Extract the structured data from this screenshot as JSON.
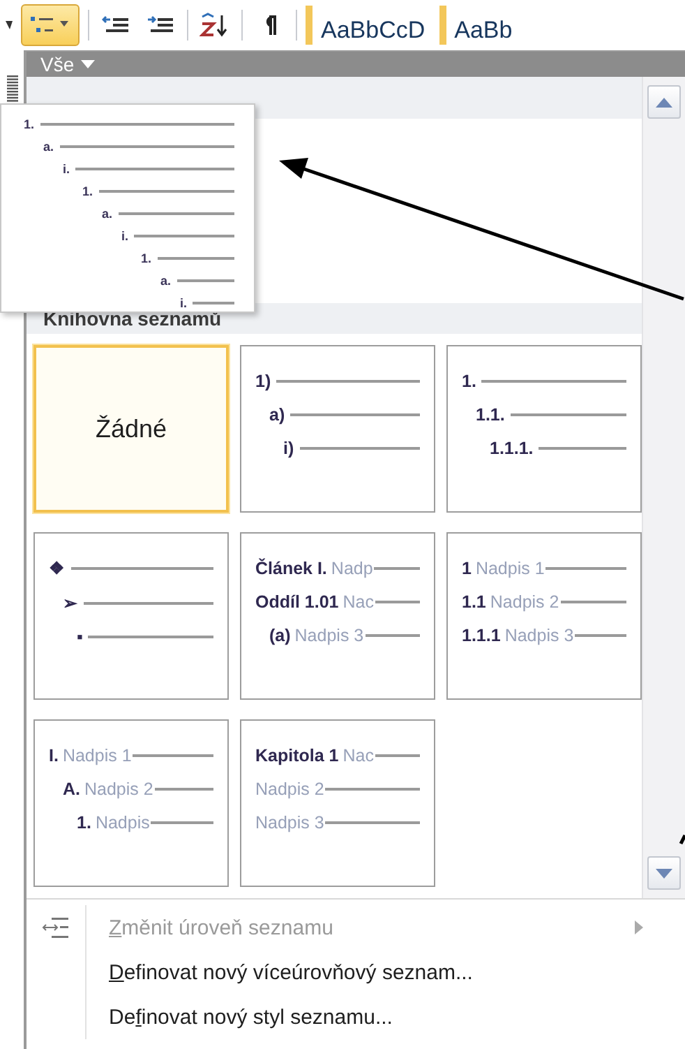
{
  "toolbar": {
    "buttons": [
      {
        "kind": "multilevel",
        "selected": true
      },
      {
        "kind": "outdent",
        "selected": false
      },
      {
        "kind": "indent",
        "selected": false
      },
      {
        "kind": "sort",
        "selected": false
      },
      {
        "kind": "pilcrow",
        "selected": false
      }
    ],
    "styles": [
      {
        "sample": "AaBbCcD"
      },
      {
        "sample": "AaBb"
      }
    ]
  },
  "gallery": {
    "filter": "Vše",
    "preview": {
      "marker": "1.",
      "children": [
        {
          "marker": "a.",
          "children": [
            {
              "marker": "i.",
              "children": [
                {
                  "marker": "1.",
                  "children": [
                    {
                      "marker": "a.",
                      "children": [
                        {
                          "marker": "i.",
                          "children": [
                            {
                              "marker": "1.",
                              "children": [
                                {
                                  "marker": "a.",
                                  "children": [
                                    {
                                      "marker": "i."
                                    }
                                  ]
                                }
                              ]
                            }
                          ]
                        }
                      ]
                    }
                  ]
                }
              ]
            }
          ]
        }
      ]
    },
    "section": "Knihovna seznamů",
    "cards": [
      {
        "kind": "text",
        "label": "Žádné",
        "selected": true
      },
      {
        "kind": "levels",
        "selected": false,
        "lines": [
          {
            "marker": "1)",
            "children": [
              {
                "marker": "a)",
                "children": [
                  {
                    "marker": "i)"
                  }
                ]
              }
            ]
          }
        ]
      },
      {
        "kind": "levels",
        "selected": false,
        "lines": [
          {
            "marker": "1.",
            "children": [
              {
                "marker": "1.1.",
                "children": [
                  {
                    "marker": "1.1.1."
                  }
                ]
              }
            ]
          }
        ]
      },
      {
        "kind": "levels",
        "selected": false,
        "lines": [
          {
            "marker": "❖",
            "children": [
              {
                "marker": "➢",
                "children": [
                  {
                    "marker": "▪"
                  }
                ]
              }
            ]
          }
        ]
      },
      {
        "kind": "levels",
        "selected": false,
        "lines": [
          {
            "marker": "Článek I.",
            "text": "Nadp"
          },
          {
            "marker": "Oddíl 1.01",
            "text": "Nac",
            "children": [
              {
                "marker": "(a)",
                "text": "Nadpis 3"
              }
            ]
          }
        ]
      },
      {
        "kind": "levels",
        "selected": false,
        "lines": [
          {
            "marker": "1",
            "text": "Nadpis 1"
          },
          {
            "marker": "1.1",
            "text": "Nadpis 2"
          },
          {
            "marker": "1.1.1",
            "text": "Nadpis 3"
          }
        ]
      },
      {
        "kind": "levels",
        "selected": false,
        "lines": [
          {
            "marker": "I.",
            "text": "Nadpis 1",
            "children": [
              {
                "marker": "A.",
                "text": "Nadpis 2",
                "children": [
                  {
                    "marker": "1.",
                    "text": "Nadpis"
                  }
                ]
              }
            ]
          }
        ]
      },
      {
        "kind": "levels",
        "selected": false,
        "lines": [
          {
            "marker": "Kapitola 1",
            "text": "Nac"
          },
          {
            "text": "Nadpis 2"
          },
          {
            "text": "Nadpis 3"
          }
        ]
      }
    ]
  },
  "menu": [
    {
      "kind": "submenu",
      "disabled": true,
      "access_key": "Z",
      "rest": "měnit úroveň seznamu"
    },
    {
      "kind": "command",
      "disabled": false,
      "access_key": "D",
      "rest": "efinovat nový víceúrovňový seznam..."
    },
    {
      "kind": "command",
      "disabled": false,
      "start": "De",
      "access_key": "f",
      "rest": "inovat nový styl seznamu..."
    }
  ]
}
